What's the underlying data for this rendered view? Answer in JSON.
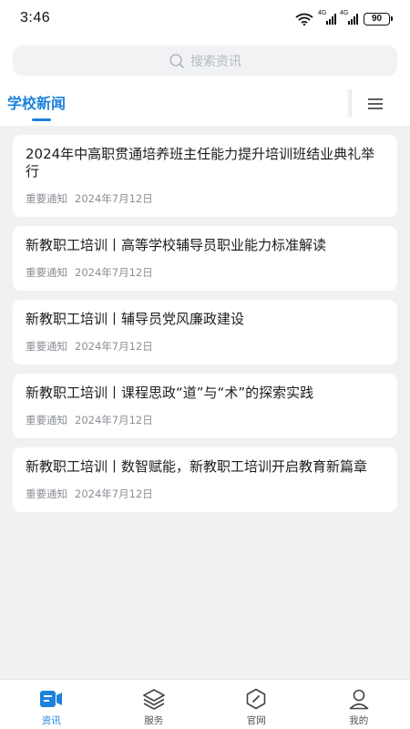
{
  "status": {
    "time": "3:46",
    "signal_tag": "4G",
    "battery": "90"
  },
  "search": {
    "placeholder": "搜索资讯"
  },
  "tabs": {
    "active_label": "学校新闻"
  },
  "articles": [
    {
      "title": "2024年中高职贯通培养班主任能力提升培训班结业典礼举行",
      "tag": "重要通知",
      "date": "2024年7月12日"
    },
    {
      "title": "新教职工培训丨高等学校辅导员职业能力标准解读",
      "tag": "重要通知",
      "date": "2024年7月12日"
    },
    {
      "title": "新教职工培训丨辅导员党风廉政建设",
      "tag": "重要通知",
      "date": "2024年7月12日"
    },
    {
      "title": "新教职工培训丨课程思政“道”与“术”的探索实践",
      "tag": "重要通知",
      "date": "2024年7月12日"
    },
    {
      "title": "新教职工培训丨数智赋能，新教职工培训开启教育新篇章",
      "tag": "重要通知",
      "date": "2024年7月12日"
    }
  ],
  "bottom_nav": [
    {
      "label": "资讯",
      "icon": "news-icon",
      "active": true
    },
    {
      "label": "服务",
      "icon": "layers-icon",
      "active": false
    },
    {
      "label": "官网",
      "icon": "compass-icon",
      "active": false
    },
    {
      "label": "我的",
      "icon": "user-icon",
      "active": false
    }
  ],
  "colors": {
    "accent": "#1c82db",
    "background": "#f0f1f3"
  }
}
